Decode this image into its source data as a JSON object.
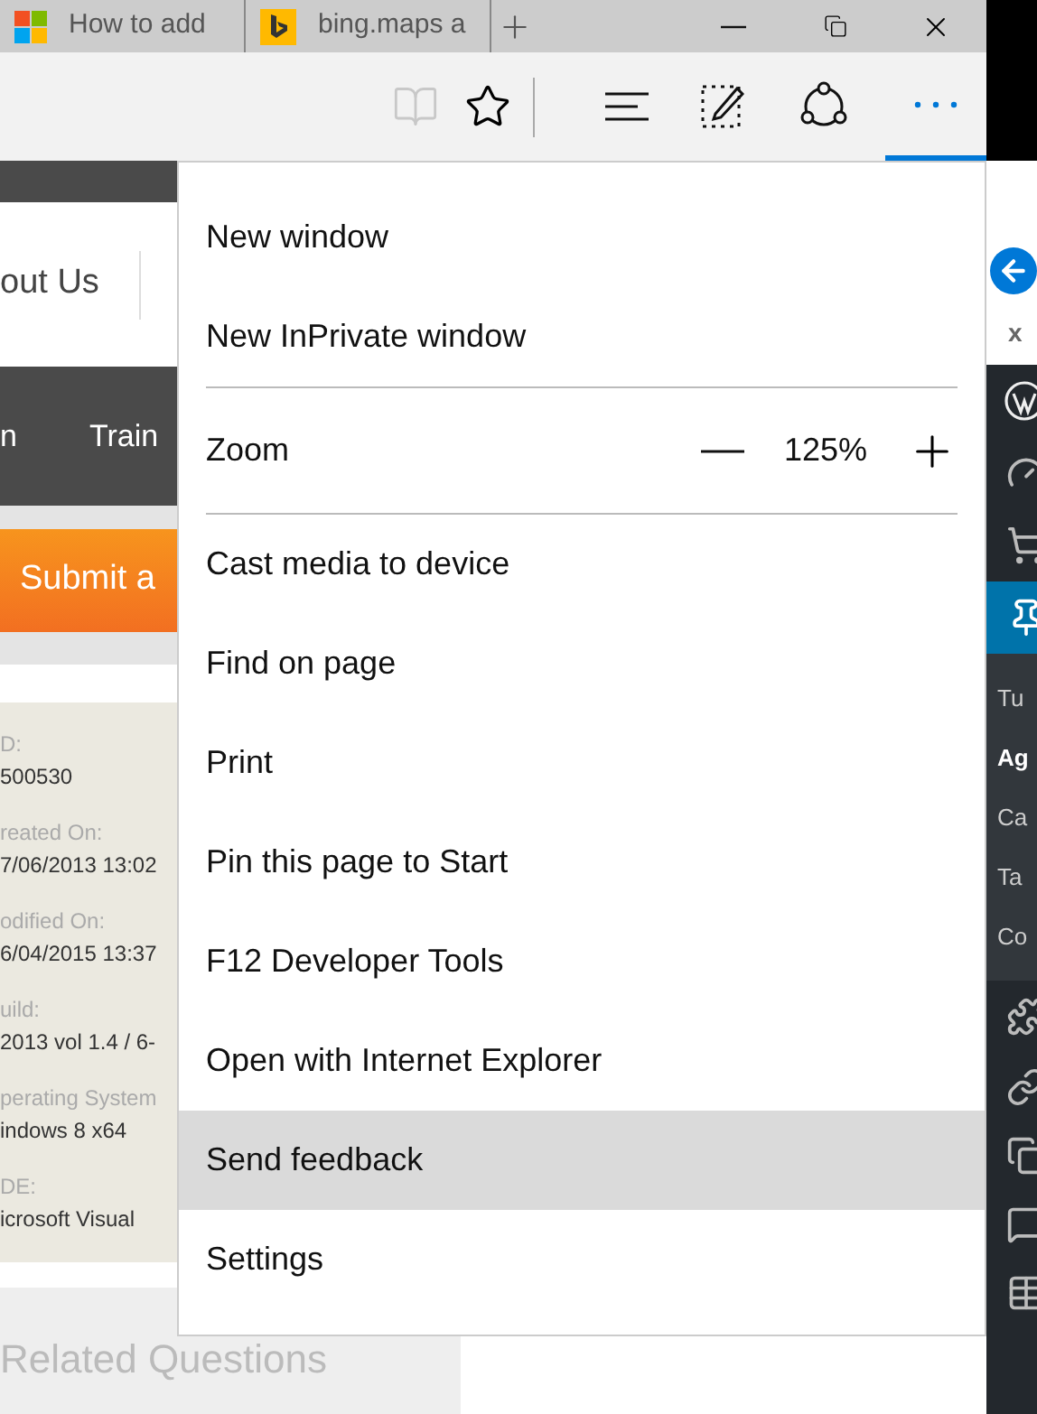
{
  "tabs": [
    {
      "kind": "windows",
      "title": "How to add"
    },
    {
      "kind": "bing",
      "title": "bing.maps a"
    }
  ],
  "toolbar": {
    "reading_view_disabled": true,
    "more_selected": true
  },
  "page": {
    "nav_link": "out Us",
    "nav_items": [
      "n",
      "Train"
    ],
    "submit_button": "Submit a",
    "fields": [
      {
        "label": "D:",
        "value": "500530"
      },
      {
        "label": "reated On:",
        "value": "7/06/2013 13:02"
      },
      {
        "label": "odified On:",
        "value": "6/04/2015 13:37"
      },
      {
        "label": "uild:",
        "value": "2013 vol 1.4 / 6-"
      },
      {
        "label": "perating System",
        "value": "indows 8 x64"
      },
      {
        "label": "DE:",
        "value": "icrosoft Visual"
      }
    ],
    "related_heading": "Related Questions"
  },
  "menu": [
    {
      "kind": "item",
      "label": "New window",
      "highlighted": false
    },
    {
      "kind": "item",
      "label": "New InPrivate window",
      "highlighted": false
    },
    {
      "kind": "divider"
    },
    {
      "kind": "zoom",
      "label": "Zoom",
      "value": "125%"
    },
    {
      "kind": "divider"
    },
    {
      "kind": "item",
      "label": "Cast media to device",
      "highlighted": false
    },
    {
      "kind": "item",
      "label": "Find on page",
      "highlighted": false
    },
    {
      "kind": "item",
      "label": "Print",
      "highlighted": false
    },
    {
      "kind": "item",
      "label": "Pin this page to Start",
      "highlighted": false
    },
    {
      "kind": "item",
      "label": "F12 Developer Tools",
      "highlighted": false
    },
    {
      "kind": "item",
      "label": "Open with Internet Explorer",
      "highlighted": false
    },
    {
      "kind": "item",
      "label": "Send feedback",
      "highlighted": true
    },
    {
      "kind": "item",
      "label": "Settings",
      "highlighted": false
    }
  ],
  "wp_sidebar": {
    "close": "x",
    "submenu": [
      {
        "label": "Tu",
        "selected": false
      },
      {
        "label": "Ag",
        "selected": true
      },
      {
        "label": "Ca",
        "selected": false
      },
      {
        "label": "Ta",
        "selected": false
      },
      {
        "label": "Co",
        "selected": false
      }
    ]
  }
}
